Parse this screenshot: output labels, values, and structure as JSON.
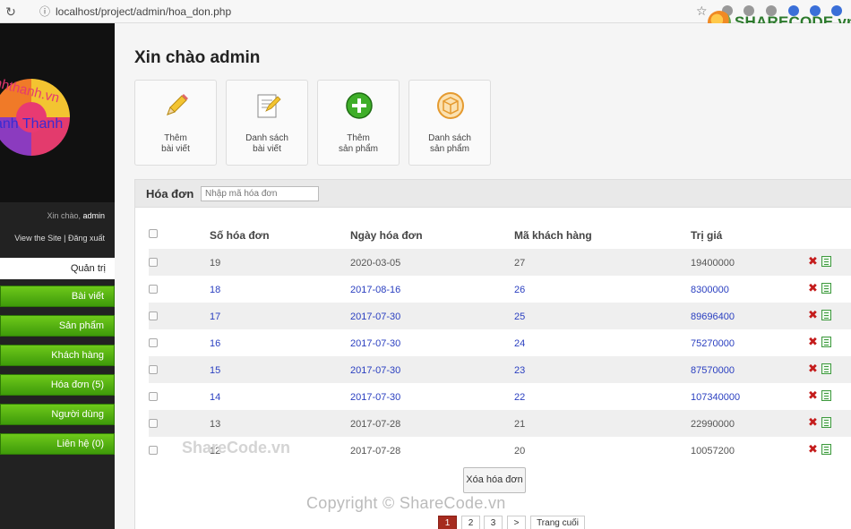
{
  "browser": {
    "url": "localhost/project/admin/hoa_don.php",
    "watermark_brand": "SHARECODE.vn"
  },
  "sidebar": {
    "site_text": "nhthanh.vn",
    "brand_name": "anh Thanh",
    "greeting_prefix": "Xin chào,",
    "greeting_user": "admin",
    "view_site": "View the Site",
    "separator": "|",
    "logout": "Đăng xuất",
    "section_title": "Quản trị",
    "menu": [
      {
        "label": "Bài viết"
      },
      {
        "label": "Sản phẩm"
      },
      {
        "label": "Khách hàng"
      },
      {
        "label": "Hóa đơn (5)"
      },
      {
        "label": "Người dùng"
      },
      {
        "label": "Liên hệ (0)"
      }
    ]
  },
  "main": {
    "welcome": "Xin chào admin",
    "tiles": [
      {
        "line1": "Thêm",
        "line2": "bài viết",
        "icon": "pencil-icon"
      },
      {
        "line1": "Danh sách",
        "line2": "bài viết",
        "icon": "document-list-icon"
      },
      {
        "line1": "Thêm",
        "line2": "sản phẩm",
        "icon": "add-circle-icon"
      },
      {
        "line1": "Danh sách",
        "line2": "sản phẩm",
        "icon": "box-icon"
      }
    ],
    "panel_title": "Hóa đơn",
    "search_placeholder": "Nhập mã hóa đơn",
    "columns": [
      "Số hóa đơn",
      "Ngày hóa đơn",
      "Mã khách hàng",
      "Trị giá"
    ],
    "rows": [
      {
        "so": "19",
        "ngay": "2020-03-05",
        "ma_kh": "27",
        "tri_gia": "19400000"
      },
      {
        "so": "18",
        "ngay": "2017-08-16",
        "ma_kh": "26",
        "tri_gia": "8300000"
      },
      {
        "so": "17",
        "ngay": "2017-07-30",
        "ma_kh": "25",
        "tri_gia": "89696400"
      },
      {
        "so": "16",
        "ngay": "2017-07-30",
        "ma_kh": "24",
        "tri_gia": "75270000"
      },
      {
        "so": "15",
        "ngay": "2017-07-30",
        "ma_kh": "23",
        "tri_gia": "87570000"
      },
      {
        "so": "14",
        "ngay": "2017-07-30",
        "ma_kh": "22",
        "tri_gia": "107340000"
      },
      {
        "so": "13",
        "ngay": "2017-07-28",
        "ma_kh": "21",
        "tri_gia": "22990000"
      },
      {
        "so": "12",
        "ngay": "2017-07-28",
        "ma_kh": "20",
        "tri_gia": "10057200"
      }
    ],
    "delete_button": "Xóa hóa đơn",
    "copyright": "Copyright © ShareCode.vn",
    "watermark": "ShareCode.vn",
    "pagination": {
      "pages": [
        "1",
        "2",
        "3"
      ],
      "next": ">",
      "last": "Trang cuối",
      "current": "1"
    }
  },
  "colors": {
    "menu_green": "#52b012",
    "link_blue": "#2a3fc0",
    "delete_red": "#c41c1c",
    "active_page": "#a62b1f"
  }
}
